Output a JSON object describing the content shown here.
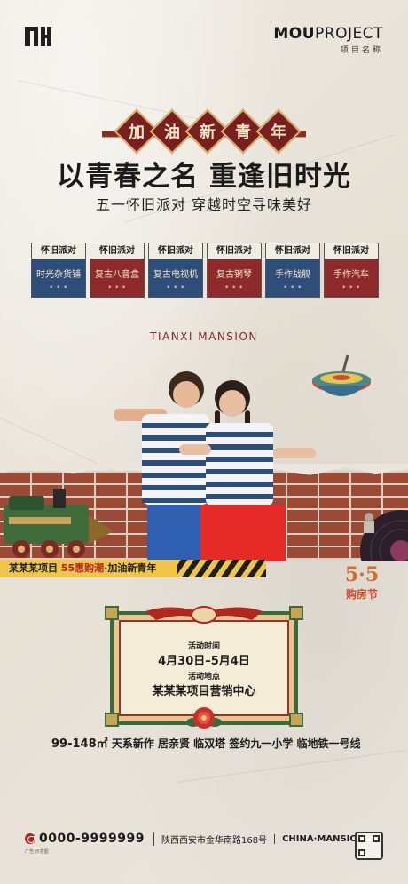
{
  "header": {
    "brand_bold": "MOU",
    "brand_light": "PROJECT",
    "brand_sub": "项目名称"
  },
  "banner": {
    "chars": [
      "加",
      "油",
      "新",
      "青",
      "年"
    ]
  },
  "headline": {
    "title": "以青春之名  重逢旧时光",
    "subtitle": "五一怀旧派对  穿越时空寻味美好"
  },
  "cards": [
    {
      "top": "怀旧派对",
      "name": "时光杂货铺",
      "color": "blue"
    },
    {
      "top": "怀旧派对",
      "name": "复古八音盒",
      "color": "red"
    },
    {
      "top": "怀旧派对",
      "name": "复古电视机",
      "color": "blue"
    },
    {
      "top": "怀旧派对",
      "name": "复古钢琴",
      "color": "red"
    },
    {
      "top": "怀旧派对",
      "name": "手作战舰",
      "color": "blue"
    },
    {
      "top": "怀旧派对",
      "name": "手作汽车",
      "color": "red"
    }
  ],
  "mansion": "TIANXI MANSION",
  "ribbon": {
    "prefix": "某某某项目 ",
    "highlight": "55惠购潮",
    "suffix": "·加油新青年"
  },
  "badge": {
    "number": "5·5",
    "text": "购房节"
  },
  "event": {
    "time_label": "活动时间",
    "time_value": "4月30日–5月4日",
    "place_label": "活动地点",
    "place_value": "某某某项目营销中心"
  },
  "features": {
    "area": "99-148㎡",
    "items": "天系新作  居亲贤  临双塔  签约九一小学  临地铁一号线"
  },
  "footer": {
    "phone": "0000-9999999",
    "address": "陕西西安市金华南路168号",
    "china": "CHINA·MANSION",
    "ad": "广告·示意图"
  },
  "colors": {
    "red": "#8e2a2b",
    "blue": "#2d4e7a",
    "yellow": "#f0c54a",
    "green": "#3a6b3f"
  }
}
